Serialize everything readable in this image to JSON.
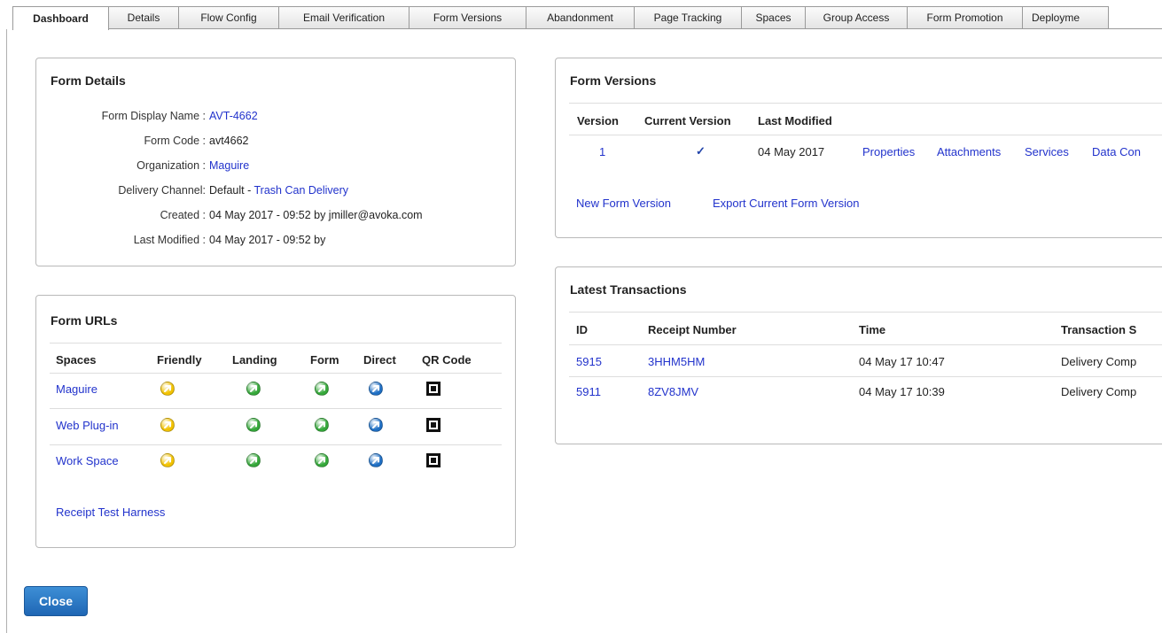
{
  "tabs": [
    "Dashboard",
    "Details",
    "Flow Config",
    "Email Verification",
    "Form Versions",
    "Abandonment",
    "Page Tracking",
    "Spaces",
    "Group Access",
    "Form Promotion",
    "Deployme"
  ],
  "active_tab": "Dashboard",
  "form_details": {
    "title": "Form Details",
    "display_name_label": "Form Display Name :",
    "display_name": "AVT-4662",
    "code_label": "Form Code :",
    "code": "avt4662",
    "organization_label": "Organization :",
    "organization": "Maguire",
    "delivery_label": "Delivery Channel:",
    "delivery_prefix": "Default - ",
    "delivery_link": "Trash Can Delivery",
    "created_label": "Created :",
    "created": "04 May 2017 - 09:52 by jmiller@avoka.com",
    "modified_label": "Last Modified :",
    "modified": "04 May 2017 - 09:52 by"
  },
  "form_urls": {
    "title": "Form URLs",
    "headers": [
      "Spaces",
      "Friendly",
      "Landing",
      "Form",
      "Direct",
      "QR Code"
    ],
    "rows": [
      {
        "space": "Maguire"
      },
      {
        "space": "Web Plug-in"
      },
      {
        "space": "Work Space"
      }
    ],
    "receipt_link": "Receipt Test Harness",
    "icon_colors": {
      "friendly": "#f2c200",
      "landing": "#35a83a",
      "form": "#35a83a",
      "direct": "#1f6fc4"
    }
  },
  "form_versions": {
    "title": "Form Versions",
    "headers": [
      "Version",
      "Current Version",
      "Last Modified"
    ],
    "row": {
      "version": "1",
      "current": "✓",
      "modified": "04 May 2017",
      "links": [
        "Properties",
        "Attachments",
        "Services",
        "Data Con"
      ]
    },
    "new_version": "New Form Version",
    "export_version": "Export Current Form Version"
  },
  "transactions": {
    "title": "Latest Transactions",
    "headers": [
      "ID",
      "Receipt Number",
      "Time",
      "Transaction S"
    ],
    "rows": [
      {
        "id": "5915",
        "receipt": "3HHM5HM",
        "time": "04 May 17 10:47",
        "status": "Delivery Comp"
      },
      {
        "id": "5911",
        "receipt": "8ZV8JMV",
        "time": "04 May 17 10:39",
        "status": "Delivery Comp"
      }
    ]
  },
  "close_label": "Close"
}
